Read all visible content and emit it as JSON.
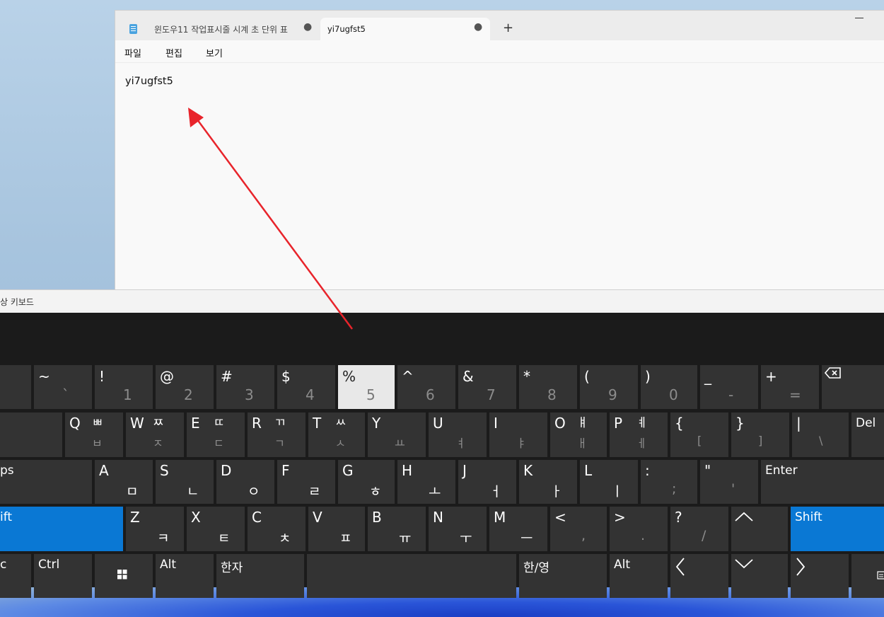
{
  "notepad": {
    "tabs": [
      {
        "title": "윈도우11 작업표시줄 시계 초 단위 표",
        "modified_dot": "●"
      },
      {
        "title": "yi7ugfst5",
        "modified_dot": "●"
      }
    ],
    "new_tab": "+",
    "menu": {
      "file": "파일",
      "edit": "편집",
      "view": "보기"
    },
    "content": "yi7ugfst5"
  },
  "osk": {
    "title": "상 키보드",
    "rows": {
      "number": [
        {
          "sym": "~",
          "sub": "`"
        },
        {
          "sym": "!",
          "sub": "1"
        },
        {
          "sym": "@",
          "sub": "2"
        },
        {
          "sym": "#",
          "sub": "3"
        },
        {
          "sym": "$",
          "sub": "4"
        },
        {
          "sym": "%",
          "sub": "5"
        },
        {
          "sym": "^",
          "sub": "6"
        },
        {
          "sym": "&",
          "sub": "7"
        },
        {
          "sym": "*",
          "sub": "8"
        },
        {
          "sym": "(",
          "sub": "9"
        },
        {
          "sym": ")",
          "sub": "0"
        },
        {
          "sym": "_",
          "sub": "-"
        },
        {
          "sym": "+",
          "sub": "="
        }
      ],
      "top": [
        {
          "main": "Q",
          "han": "ㅃ",
          "hansub": "ㅂ"
        },
        {
          "main": "W",
          "han": "ㅉ",
          "hansub": "ㅈ"
        },
        {
          "main": "E",
          "han": "ㄸ",
          "hansub": "ㄷ"
        },
        {
          "main": "R",
          "han": "ㄲ",
          "hansub": "ㄱ"
        },
        {
          "main": "T",
          "han": "ㅆ",
          "hansub": "ㅅ"
        },
        {
          "main": "Y",
          "han": "",
          "hansub": "ㅛ"
        },
        {
          "main": "U",
          "han": "",
          "hansub": "ㅕ"
        },
        {
          "main": "I",
          "han": "",
          "hansub": "ㅑ"
        },
        {
          "main": "O",
          "han": "ㅒ",
          "hansub": "ㅐ"
        },
        {
          "main": "P",
          "han": "ㅖ",
          "hansub": "ㅔ"
        },
        {
          "main": "{",
          "han": "",
          "hansub": "["
        },
        {
          "main": "}",
          "han": "",
          "hansub": "]"
        },
        {
          "main": "|",
          "han": "",
          "hansub": "\\"
        }
      ],
      "home": [
        {
          "main": "A",
          "han": "ㅁ"
        },
        {
          "main": "S",
          "han": "ㄴ"
        },
        {
          "main": "D",
          "han": "ㅇ"
        },
        {
          "main": "F",
          "han": "ㄹ"
        },
        {
          "main": "G",
          "han": "ㅎ"
        },
        {
          "main": "H",
          "han": "ㅗ"
        },
        {
          "main": "J",
          "han": "ㅓ"
        },
        {
          "main": "K",
          "han": "ㅏ"
        },
        {
          "main": "L",
          "han": "ㅣ"
        },
        {
          "main": ":",
          "han": ";"
        },
        {
          "main": "\"",
          "han": "'"
        }
      ],
      "bottom": [
        {
          "main": "Z",
          "han": "ㅋ"
        },
        {
          "main": "X",
          "han": "ㅌ"
        },
        {
          "main": "C",
          "han": "ㅊ"
        },
        {
          "main": "V",
          "han": "ㅍ"
        },
        {
          "main": "B",
          "han": "ㅠ"
        },
        {
          "main": "N",
          "han": "ㅜ"
        },
        {
          "main": "M",
          "han": "ㅡ"
        },
        {
          "main": "<",
          "han": ","
        },
        {
          "main": ">",
          "han": "."
        },
        {
          "main": "?",
          "han": "/"
        }
      ]
    },
    "labels": {
      "del": "Del",
      "caps": "ps",
      "enter": "Enter",
      "shift_left": "ift",
      "shift_right": "Shift",
      "esc": "c",
      "ctrl": "Ctrl",
      "alt_left": "Alt",
      "hanja": "한자",
      "han_eng": "한/영",
      "alt_right": "Alt"
    },
    "highlighted_key": "5",
    "colors": {
      "key": "#333333",
      "active": "#0a78d4",
      "highlight": "#e8e8e8",
      "background": "#1b1b1b"
    }
  }
}
